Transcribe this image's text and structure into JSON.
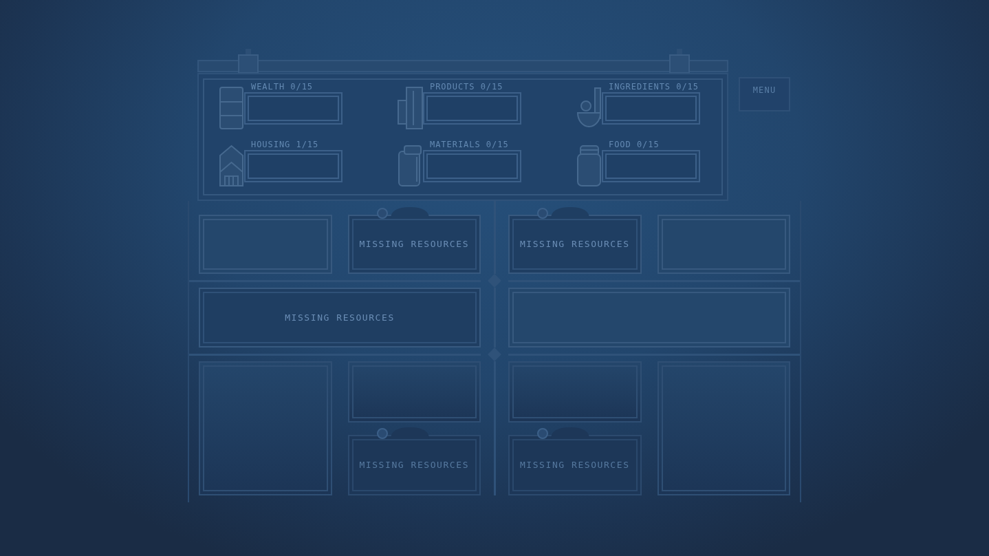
{
  "menu_button": {
    "label": "MENU"
  },
  "resources": [
    {
      "kind": "wealth",
      "label": "WEALTH 0/15"
    },
    {
      "kind": "products",
      "label": "PRODUCTS 0/15"
    },
    {
      "kind": "ingredients",
      "label": "INGREDIENTS 0/15"
    },
    {
      "kind": "housing",
      "label": "HOUSING 1/15"
    },
    {
      "kind": "materials",
      "label": "MATERIALS 0/15"
    },
    {
      "kind": "food",
      "label": "FOOD 0/15"
    }
  ],
  "board": [
    {
      "kind": "quad",
      "slots": [
        {
          "kind": "empty"
        },
        {
          "kind": "blocked",
          "label": "MISSING RESOURCES"
        },
        {
          "kind": "blocked",
          "label": "MISSING RESOURCES"
        },
        {
          "kind": "empty"
        }
      ]
    },
    {
      "kind": "pair",
      "slots": [
        {
          "kind": "blocked",
          "label": "MISSING RESOURCES"
        },
        {
          "kind": "empty"
        }
      ]
    },
    {
      "kind": "stacks",
      "columns": [
        {
          "slots": [
            {
              "kind": "empty"
            }
          ]
        },
        {
          "slots": [
            {
              "kind": "empty"
            },
            {
              "kind": "blocked",
              "label": "MISSING RESOURCES"
            }
          ]
        },
        {
          "slots": [
            {
              "kind": "empty"
            },
            {
              "kind": "blocked",
              "label": "MISSING RESOURCES"
            }
          ]
        },
        {
          "slots": [
            {
              "kind": "empty"
            }
          ]
        }
      ]
    }
  ]
}
